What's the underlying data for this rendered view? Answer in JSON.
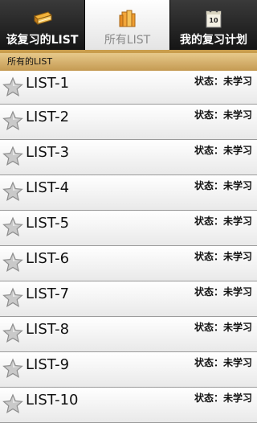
{
  "tabs": [
    {
      "label": "该复习的LIST",
      "icon": "book-icon"
    },
    {
      "label": "所有LIST",
      "icon": "stack-books-icon"
    },
    {
      "label": "我的复习计划",
      "icon": "calendar-icon"
    }
  ],
  "calendar_day": "10",
  "section_title": "所有的LIST",
  "items": [
    {
      "title": "LIST-1",
      "status": "状态：未学习"
    },
    {
      "title": "LIST-2",
      "status": "状态：未学习"
    },
    {
      "title": "LIST-3",
      "status": "状态：未学习"
    },
    {
      "title": "LIST-4",
      "status": "状态：未学习"
    },
    {
      "title": "LIST-5",
      "status": "状态：未学习"
    },
    {
      "title": "LIST-6",
      "status": "状态：未学习"
    },
    {
      "title": "LIST-7",
      "status": "状态：未学习"
    },
    {
      "title": "LIST-8",
      "status": "状态：未学习"
    },
    {
      "title": "LIST-9",
      "status": "状态：未学习"
    },
    {
      "title": "LIST-10",
      "status": "状态：未学习"
    }
  ],
  "colors": {
    "accent": "#c99d4c",
    "header_bg": "#e0bf7c",
    "tab_dark": "#2a2a2a"
  }
}
